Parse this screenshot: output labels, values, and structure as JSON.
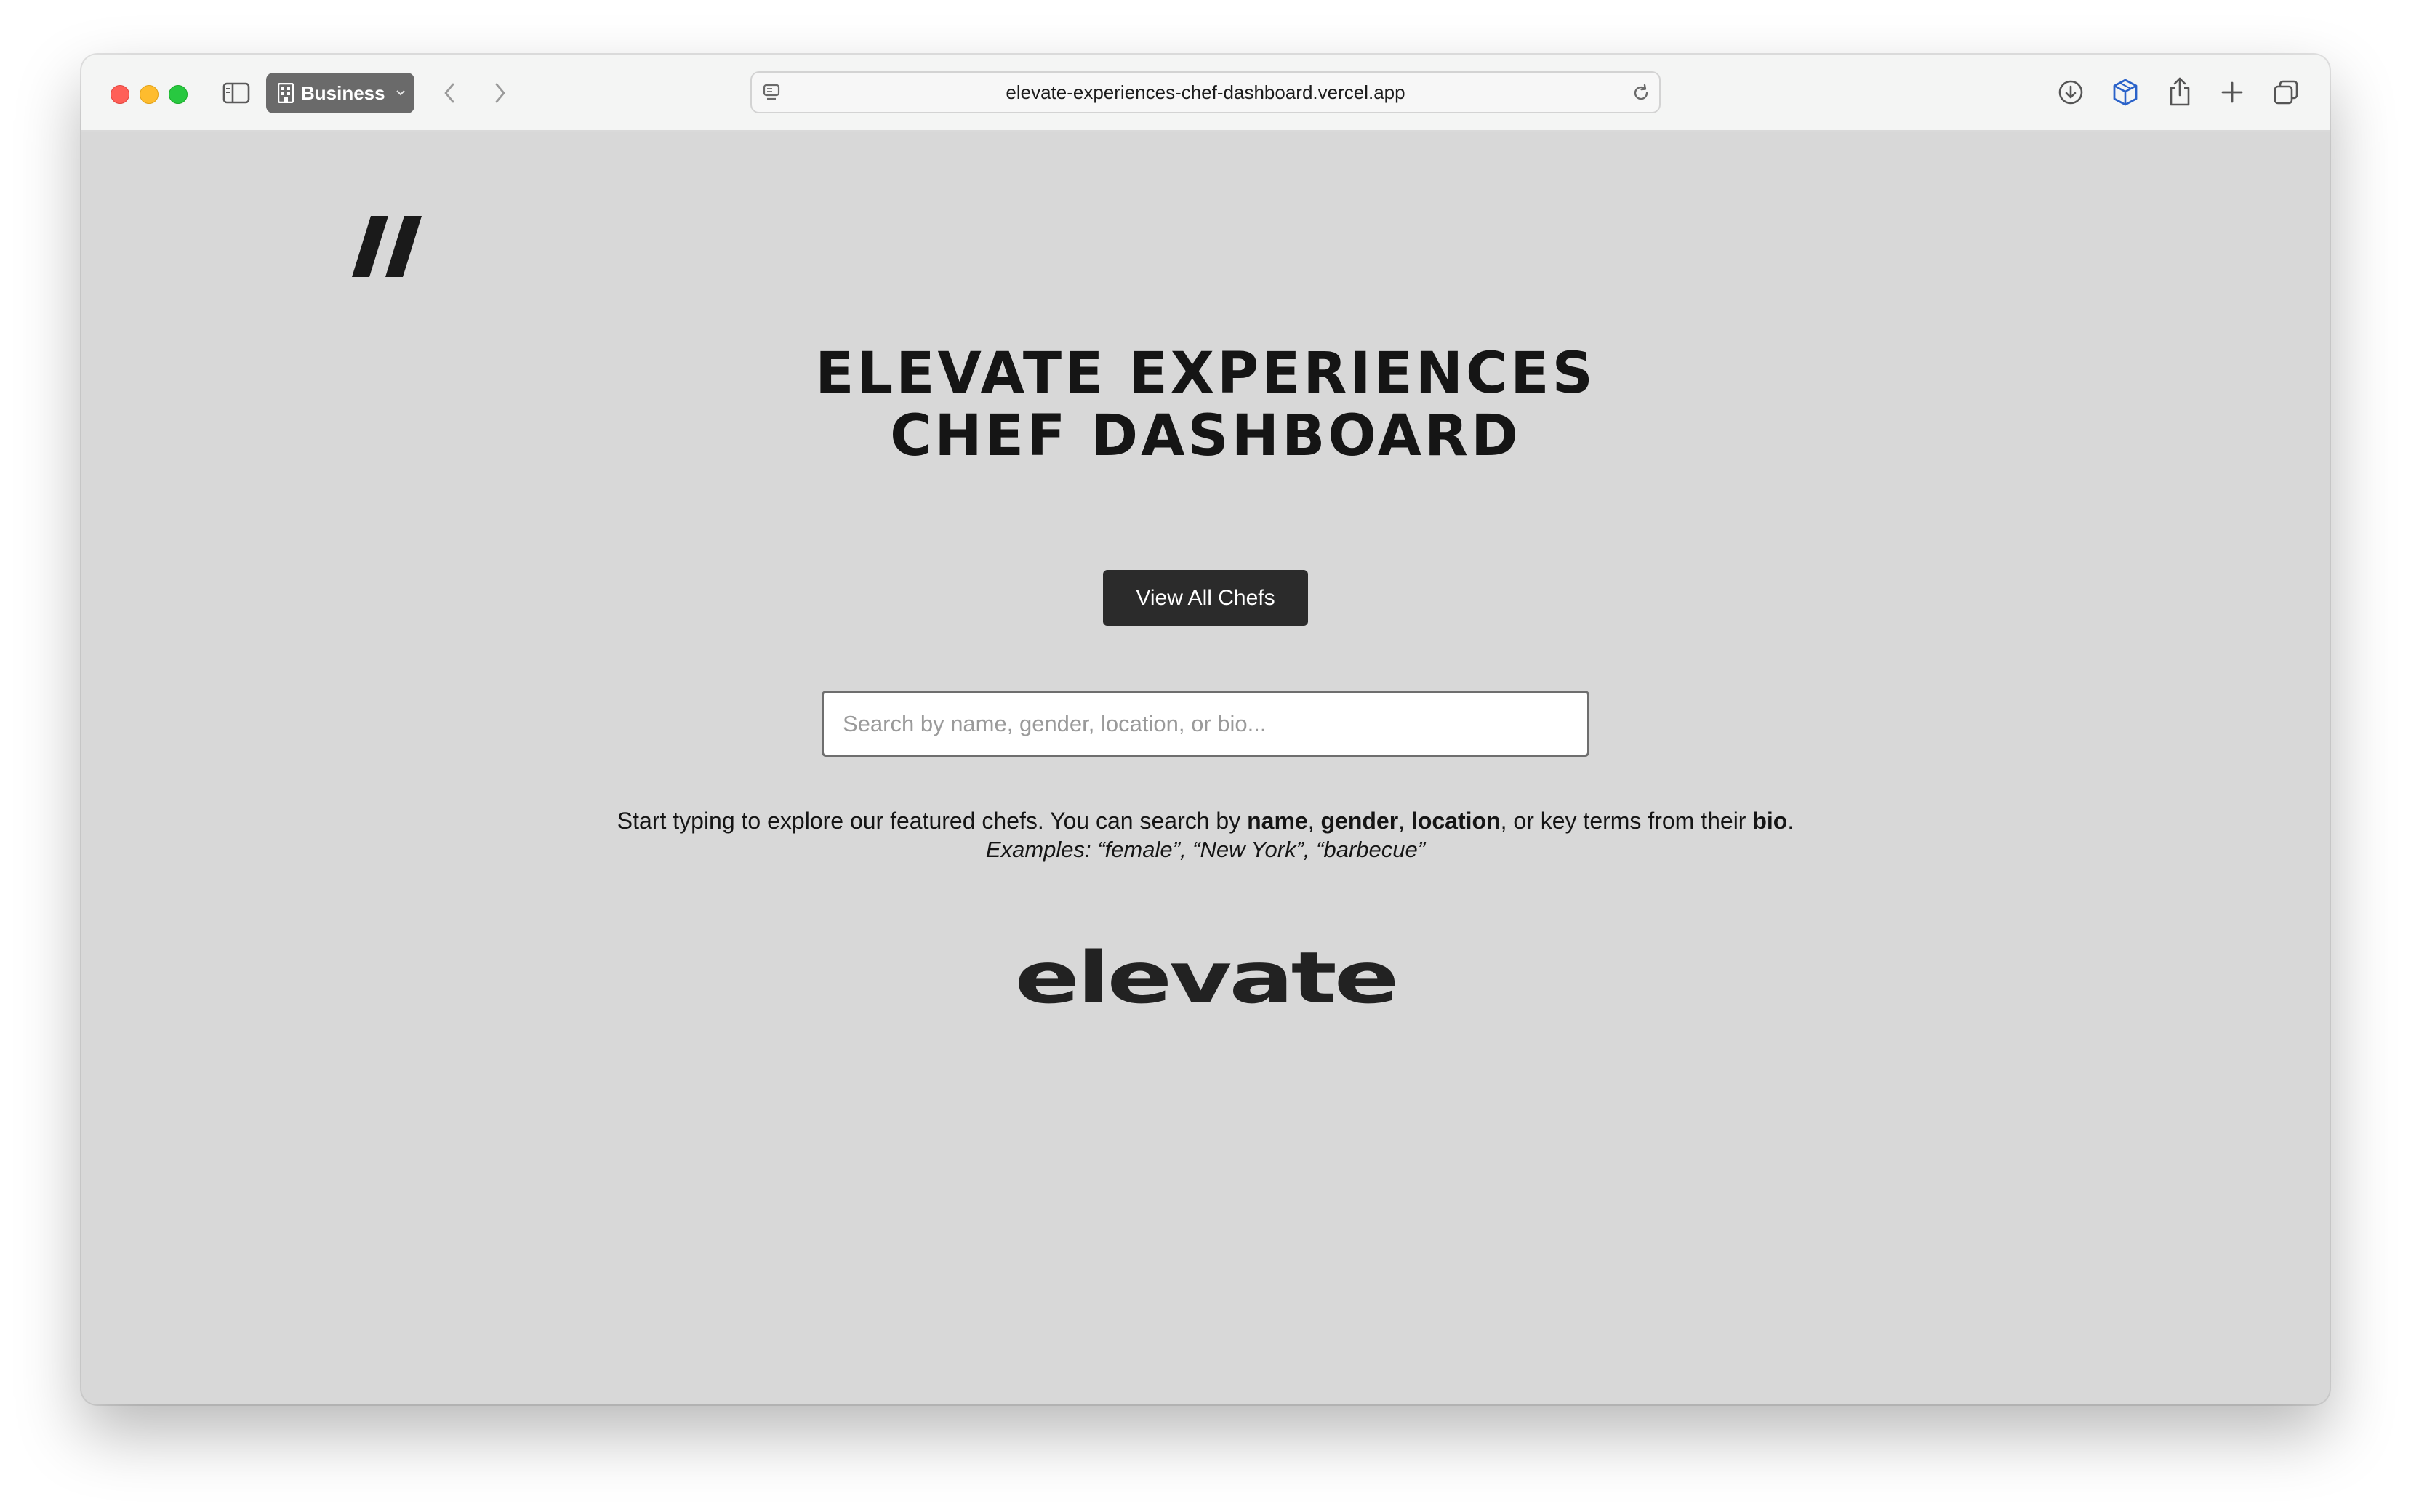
{
  "browser": {
    "profile_label": "Business",
    "url": "elevate-experiences-chef-dashboard.vercel.app"
  },
  "page": {
    "title_line1": "ELEVATE EXPERIENCES",
    "title_line2": "CHEF DASHBOARD",
    "view_button_label": "View All Chefs",
    "search": {
      "placeholder": "Search by name, gender, location, or bio...",
      "value": ""
    },
    "help": {
      "prefix": "Start typing to explore our featured chefs. You can search by ",
      "term_name": "name",
      "sep1": ", ",
      "term_gender": "gender",
      "sep2": ", ",
      "term_location": "location",
      "mid": ", or key terms from their ",
      "term_bio": "bio",
      "suffix": "."
    },
    "examples": "Examples: “female”, “New York”, “barbecue”",
    "brand": "elevate"
  },
  "icons": {
    "sidebar": "sidebar-icon",
    "back": "chevron-left-icon",
    "forward": "chevron-right-icon",
    "reader": "reader-icon",
    "reload": "reload-icon",
    "downloads": "download-icon",
    "extension": "cube-icon",
    "share": "share-icon",
    "new_tab": "plus-icon",
    "tabs": "tabs-overview-icon",
    "logo": "double-slash-logo-icon"
  }
}
